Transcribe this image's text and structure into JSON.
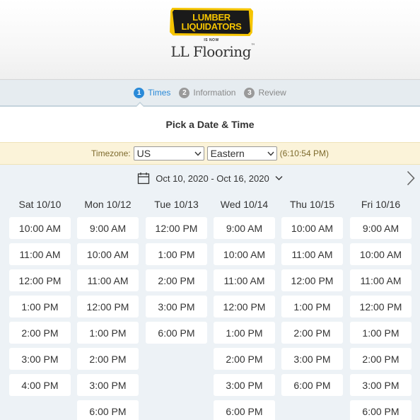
{
  "brand": {
    "line1": "LUMBER",
    "line2": "LIQUIDATORS",
    "is_now": "IS NOW",
    "name": "LL Flooring",
    "tm": "™",
    "badge_color": "#f5c400"
  },
  "steps": [
    {
      "num": "1",
      "label": "Times",
      "active": true
    },
    {
      "num": "2",
      "label": "Information",
      "active": false
    },
    {
      "num": "3",
      "label": "Review",
      "active": false
    }
  ],
  "title": "Pick a Date & Time",
  "timezone": {
    "label": "Timezone:",
    "country": "US",
    "zone": "Eastern",
    "current_time": "(6:10:54 PM)"
  },
  "date_range": {
    "icon": "calendar-icon",
    "label": "Oct 10, 2020 - Oct 16, 2020",
    "next_icon": "chevron-right-icon"
  },
  "accent_color": "#2a8ad8",
  "days": [
    {
      "label": "Sat 10/10",
      "slots": [
        "10:00 AM",
        "11:00 AM",
        "12:00 PM",
        "1:00 PM",
        "2:00 PM",
        "3:00 PM",
        "4:00 PM"
      ]
    },
    {
      "label": "Mon 10/12",
      "slots": [
        "9:00 AM",
        "10:00 AM",
        "11:00 AM",
        "12:00 PM",
        "1:00 PM",
        "2:00 PM",
        "3:00 PM",
        "6:00 PM"
      ]
    },
    {
      "label": "Tue 10/13",
      "slots": [
        "12:00 PM",
        "1:00 PM",
        "2:00 PM",
        "3:00 PM",
        "6:00 PM"
      ]
    },
    {
      "label": "Wed 10/14",
      "slots": [
        "9:00 AM",
        "10:00 AM",
        "11:00 AM",
        "12:00 PM",
        "1:00 PM",
        "2:00 PM",
        "3:00 PM",
        "6:00 PM"
      ]
    },
    {
      "label": "Thu 10/15",
      "slots": [
        "10:00 AM",
        "11:00 AM",
        "12:00 PM",
        "1:00 PM",
        "2:00 PM",
        "3:00 PM",
        "6:00 PM"
      ]
    },
    {
      "label": "Fri 10/16",
      "slots": [
        "9:00 AM",
        "10:00 AM",
        "11:00 AM",
        "12:00 PM",
        "1:00 PM",
        "2:00 PM",
        "3:00 PM",
        "6:00 PM"
      ]
    }
  ]
}
